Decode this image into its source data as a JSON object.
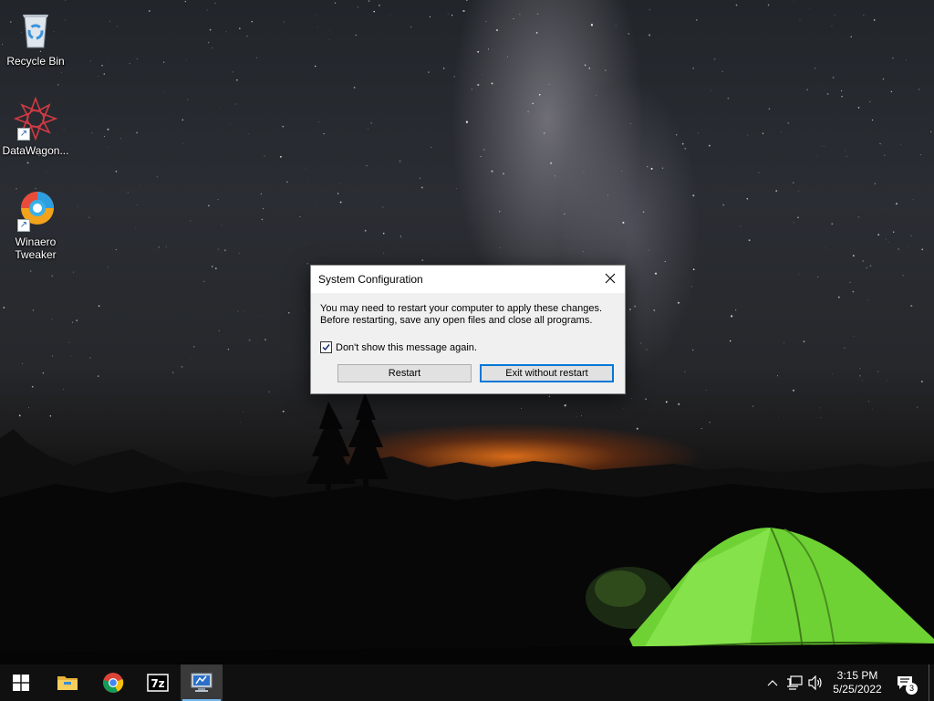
{
  "desktop_icons": [
    {
      "label": "Recycle Bin",
      "icon": "recycle-bin-icon"
    },
    {
      "label": "DataWagon...",
      "icon": "datawagon-icon"
    },
    {
      "label": "Winaero Tweaker",
      "icon": "winaero-tweaker-icon"
    }
  ],
  "dialog": {
    "title": "System Configuration",
    "message_line1": "You may need to restart your computer to apply these changes.",
    "message_line2": "Before restarting, save any open files and close all programs.",
    "checkbox_label": "Don't show this message again.",
    "checkbox_checked": true,
    "restart_label": "Restart",
    "exit_label": "Exit without restart"
  },
  "taskbar": {
    "items": [
      {
        "name": "start-button",
        "icon": "windows-logo-icon"
      },
      {
        "name": "file-explorer",
        "icon": "folder-icon"
      },
      {
        "name": "google-chrome",
        "icon": "chrome-icon"
      },
      {
        "name": "7-zip",
        "icon": "7zip-icon"
      },
      {
        "name": "system-configuration",
        "icon": "msconfig-icon"
      }
    ],
    "tray": {
      "time": "3:15 PM",
      "date": "5/25/2022",
      "notification_count": "3"
    }
  },
  "colors": {
    "accent": "#0078d7",
    "taskbar_bg": "#101010",
    "running_indicator": "#76b9ed",
    "tent_green": "#7cd83a",
    "horizon_glow": "#e27019"
  }
}
